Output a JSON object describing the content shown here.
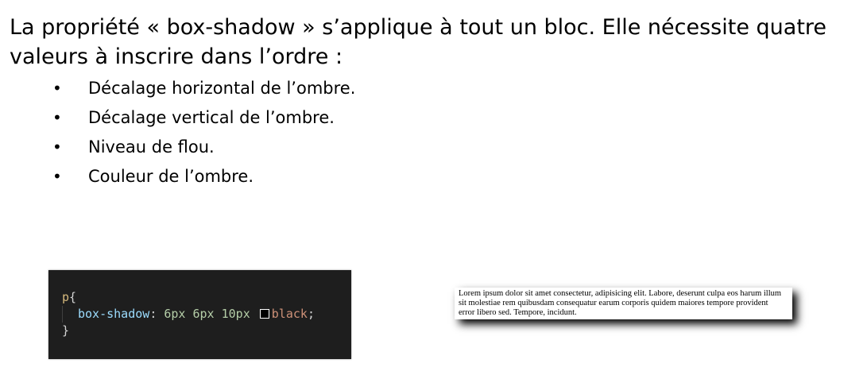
{
  "intro": "La propriété « box-shadow » s’applique à tout un bloc. Elle nécessite quatre valeurs à inscrire dans l’ordre :",
  "bullet_symbol": "•",
  "bullets": [
    "Décalage horizontal de l’ombre.",
    "Décalage vertical de l’ombre.",
    "Niveau de flou.",
    "Couleur de l’ombre."
  ],
  "code": {
    "selector": "p",
    "open_brace": "{",
    "property": "box-shadow",
    "colon": ":",
    "values": [
      "6px",
      "6px",
      "10px"
    ],
    "color_value": "black",
    "semicolon": ";",
    "close_brace": "}",
    "swatch_color": "#000000",
    "background": "#1e1e1e"
  },
  "demo_paragraph": "Lorem ipsum dolor sit amet consectetur, adipisicing elit. Labore, deserunt culpa eos harum illum sit molestiae rem quibusdam consequatur earum corporis quidem maiores tempore provident error libero sed. Tempore, incidunt."
}
